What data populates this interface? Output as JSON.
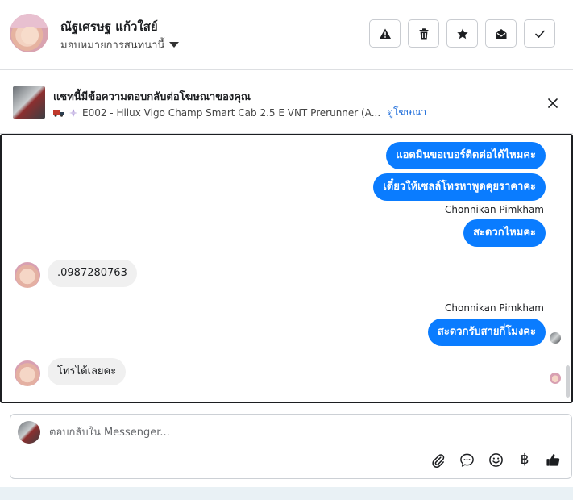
{
  "header": {
    "contact_name": "ณัฐเศรษฐ แก้วใสย์",
    "assign_label": "มอบหมายการสนทนานี้",
    "actions": [
      {
        "name": "report-icon"
      },
      {
        "name": "trash-icon"
      },
      {
        "name": "star-icon"
      },
      {
        "name": "mark-unread-icon"
      },
      {
        "name": "check-icon"
      }
    ]
  },
  "ad": {
    "title": "แชทนี้มีข้อความตอบกลับต่อโฆษณาของคุณ",
    "product": "E002 - Hilux Vigo Champ Smart Cab 2.5 E VNT Prerunner (A...",
    "link": "ดูโฆษณา"
  },
  "messages": {
    "out1": "แอดมินขอเบอร์ติดต่อได้ไหมคะ",
    "out2": "เดี๋ยวให้เซลล์โทรหาพูดคุยราคาคะ",
    "sender1": "Chonnikan Pimkham",
    "out3": "สะดวกไหมคะ",
    "in1": ".0987280763",
    "sender2": "Chonnikan Pimkham",
    "out4": "สะดวกรับสายกี่โมงคะ",
    "in2": "โทรได้เลยคะ"
  },
  "composer": {
    "placeholder": "ตอบกลับใน Messenger...",
    "baht_symbol": "฿"
  },
  "colors": {
    "outgoing_bubble": "#0a7cff",
    "incoming_bubble": "#f0f0f0",
    "link": "#216fdb"
  }
}
